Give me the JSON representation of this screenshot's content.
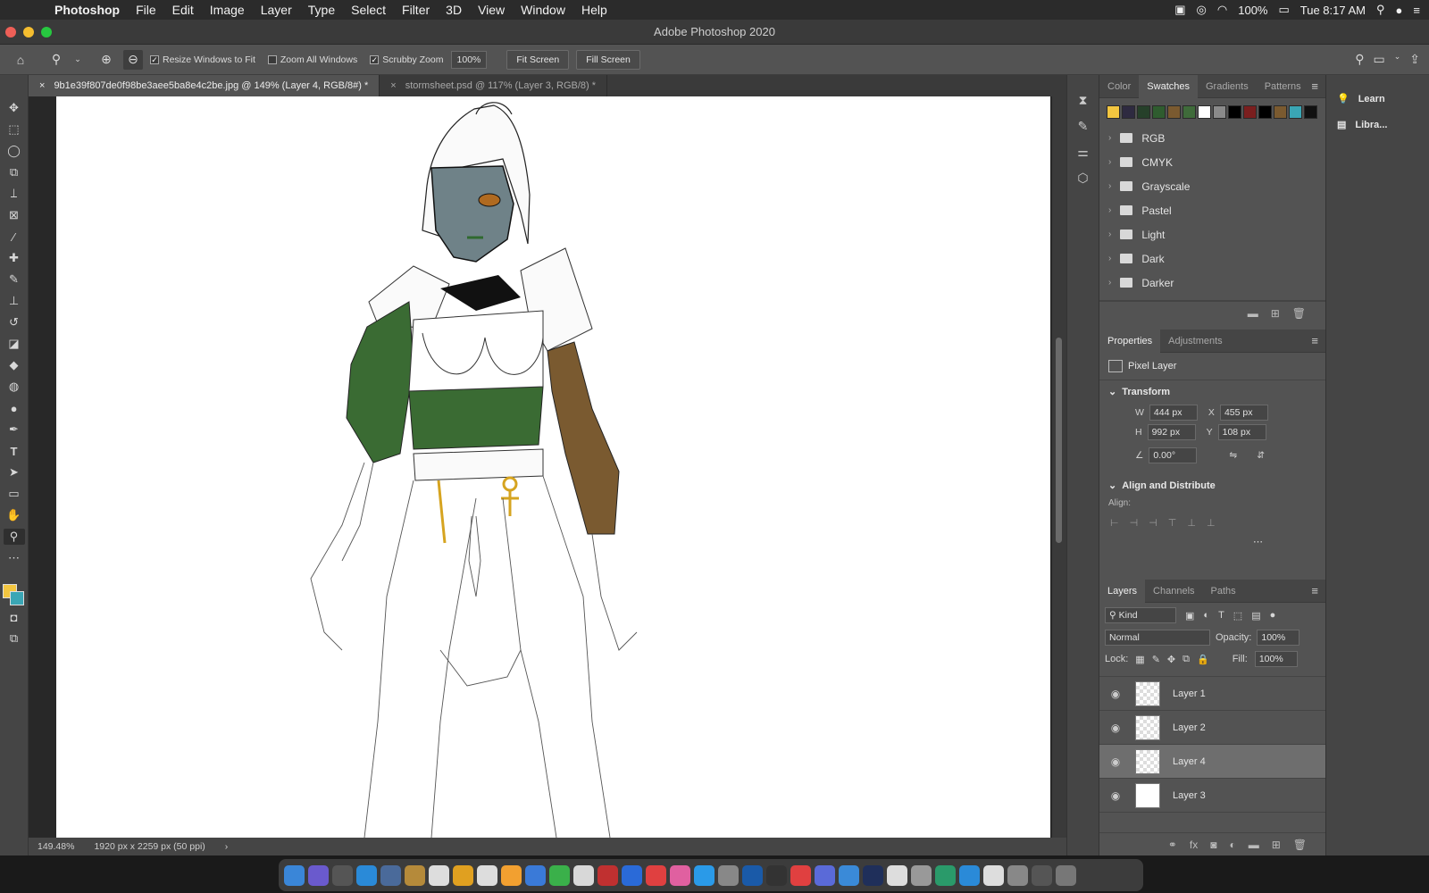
{
  "menubar": {
    "app": "Photoshop",
    "items": [
      "File",
      "Edit",
      "Image",
      "Layer",
      "Type",
      "Select",
      "Filter",
      "3D",
      "View",
      "Window",
      "Help"
    ],
    "battery": "100%",
    "clock": "Tue 8:17 AM"
  },
  "window": {
    "title": "Adobe Photoshop 2020"
  },
  "options": {
    "resize_windows": "Resize Windows to Fit",
    "zoom_all": "Zoom All Windows",
    "scrubby": "Scrubby Zoom",
    "zoom_value": "100%",
    "fit_screen": "Fit Screen",
    "fill_screen": "Fill Screen"
  },
  "doc_tabs": [
    {
      "label": "9b1e39f807de0f98be3aee5ba8e4c2be.jpg @ 149% (Layer 4, RGB/8#) *"
    },
    {
      "label": "stormsheet.psd @ 117% (Layer 3, RGB/8) *"
    }
  ],
  "status": {
    "zoom": "149.48%",
    "doc_size": "1920 px x 2259 px (50 ppi)"
  },
  "swatches_panel": {
    "tabs": [
      "Color",
      "Swatches",
      "Gradients",
      "Patterns"
    ],
    "colors": [
      "#f3c640",
      "#2e2a40",
      "#26402a",
      "#2f5c2f",
      "#7a5a30",
      "#3f6b3a",
      "#ffffff",
      "#8a8a8a",
      "#000000",
      "#7a1e1e",
      "#000000",
      "#7a5a30",
      "#3aa6b5",
      "#111111"
    ],
    "folders": [
      "RGB",
      "CMYK",
      "Grayscale",
      "Pastel",
      "Light",
      "Dark",
      "Darker"
    ]
  },
  "properties_panel": {
    "tabs": [
      "Properties",
      "Adjustments"
    ],
    "layer_type": "Pixel Layer",
    "transform_title": "Transform",
    "w": "444 px",
    "x": "455 px",
    "h": "992 px",
    "y": "108 px",
    "angle": "0.00°",
    "align_title": "Align and Distribute",
    "align_label": "Align:"
  },
  "layers_panel": {
    "tabs": [
      "Layers",
      "Channels",
      "Paths"
    ],
    "kind": "Kind",
    "blend_mode": "Normal",
    "opacity_label": "Opacity:",
    "opacity": "100%",
    "lock_label": "Lock:",
    "fill_label": "Fill:",
    "fill": "100%",
    "layers": [
      {
        "name": "Layer 1",
        "selected": false
      },
      {
        "name": "Layer 2",
        "selected": false
      },
      {
        "name": "Layer 4",
        "selected": true
      },
      {
        "name": "Layer 3",
        "selected": false
      }
    ]
  },
  "learn_panel": {
    "learn": "Learn",
    "libraries": "Libra..."
  }
}
